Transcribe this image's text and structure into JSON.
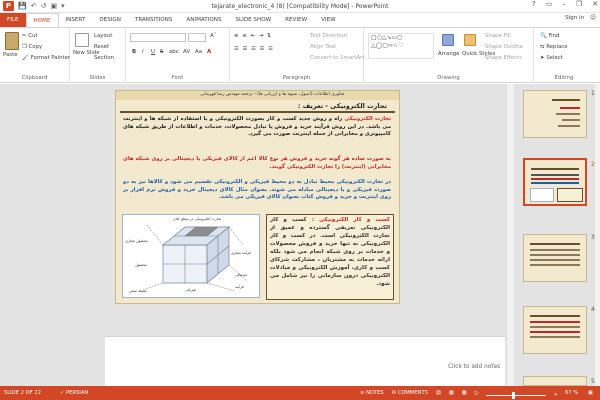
{
  "window": {
    "title": "tejarate_electronic_4 (8) [Compatibility Mode] - PowerPoint",
    "help": "?",
    "signin": "Sign in"
  },
  "tabs": [
    "FILE",
    "HOME",
    "INSERT",
    "DESIGN",
    "TRANSITIONS",
    "ANIMATIONS",
    "SLIDE SHOW",
    "REVIEW",
    "VIEW"
  ],
  "ribbon": {
    "clipboard": {
      "label": "Clipboard",
      "paste": "Paste",
      "cut": "Cut",
      "copy": "Copy",
      "format_painter": "Format Painter"
    },
    "slides": {
      "label": "Slides",
      "new_slide": "New Slide",
      "layout": "Layout",
      "reset": "Reset",
      "section": "Section"
    },
    "font": {
      "label": "Font",
      "bold": "B",
      "italic": "I",
      "underline": "U",
      "strike": "S",
      "shadow": "abc",
      "spacing": "AV",
      "case": "Aa",
      "color": "A"
    },
    "paragraph": {
      "label": "Paragraph",
      "text_direction": "Text Direction",
      "align_text": "Align Text",
      "convert_smartart": "Convert to SmartArt"
    },
    "drawing": {
      "label": "Drawing",
      "arrange": "Arrange",
      "quick_styles": "Quick Styles",
      "shape_fill": "Shape Fill",
      "shape_outline": "Shape Outline",
      "shape_effects": "Shape Effects"
    },
    "editing": {
      "label": "Editing",
      "find": "Find",
      "replace": "Replace",
      "select": "Select"
    }
  },
  "slide": {
    "subtitle": "فناوری اطلاعات (اصول، شیوه ها و ارزیابی ها) - ترجمه مهندس رضا قهرمانی",
    "heading": "تجارت الکترونیکی - تعریف :",
    "p1_kw": "تجارت الکترونیکی",
    "p1": " راه و روش جدید کسب و کار بصورت الکترونیکی و با استفاده از شبکه ها و اینترنت می باشد. در این روش فرآیند خرید و فروش یا تبادل محصولات، خدمات و اطلاعات از طریق شبکه های کامپیوتری و مخابراتی از جمله اینترنت صورت می گیرد.",
    "p2": "به صورت ساده هر گونه خرید و فروش هر نوع کالا اعم از کالای فیزیکی یا دیجیتالی بر روی شبکه های مخابراتی (اینترنت) را تجارت الکترونیکی گویند.",
    "p3": "در تجارت الکترونیکی محیط تبادل به دو محیط فیزیکی و الکترونیکی تقسیم می شود و کالاها نیز به دو صورت فیزیکی و یا دیجیتالی مبادله می شوند. بعنوان مثال کالای دیجیتال خرید و فروش نرم افزار بر روی اینترنت و خرید و فروش کتاب بعنوان کالای فیزیکی می باشد.",
    "box_kw": "کسب و کار الکترونیکی :",
    "box_text": " کسب و کار الکترونیکی تعریفی گسترده و عمیق از تجارت الکترونیکی است. در کسب و کار الکترونیکی نه تنها خرید و فروش محصولات و خدمات بر روی شبکه انجام می شود بلکه ارائه خدمات به مشتریان ، مشارکت شرکای کسب و کاری، آموزش الکترونیکی و مبادلات الکترونیکی درون سازمانی را نیز شامل می شود.",
    "diagram": {
      "top_label": "تجارت الکترونیکی در سطح کلان",
      "left_axis": "محصول مجازی",
      "right_axis": "فرآیند مجازی",
      "bottom_label": "محیط سنتی",
      "product": "محصول",
      "process": "فرآیند",
      "physical": "فیزیکی",
      "digital": "دیجیتالی"
    }
  },
  "notes": {
    "placeholder": "Click to add notes"
  },
  "thumbnails": [
    "1",
    "2",
    "3",
    "4",
    "5"
  ],
  "status": {
    "slide": "SLIDE 2 OF 22",
    "language": "PERSIAN",
    "notes": "NOTES",
    "comments": "COMMENTS",
    "zoom": "67 %"
  },
  "colors": {
    "accent": "#d24726",
    "slide_bg": "#f3e9cf",
    "red_text": "#c0272d",
    "blue_text": "#1c5fa8"
  }
}
